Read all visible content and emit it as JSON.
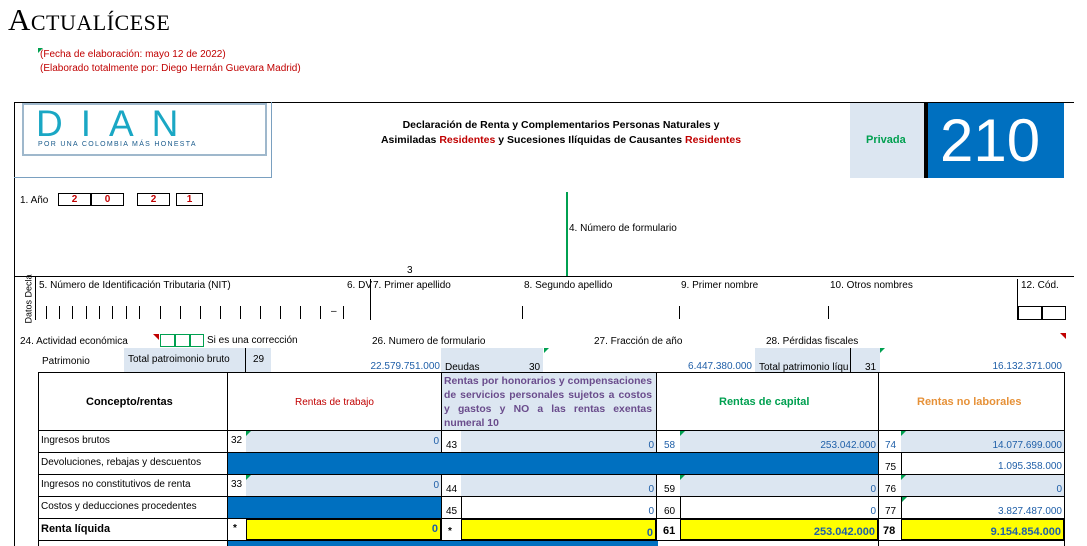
{
  "brand": "Actualícese",
  "notes": {
    "date": "(Fecha de elaboración: mayo 12 de 2022)",
    "author": "(Elaborado totalmente por: Diego Hernán Guevara Madrid)"
  },
  "header": {
    "logo_text": "DIAN",
    "logo_slogan": "POR UNA COLOMBIA MÁS HONESTA",
    "title_line1": "Declaración de Renta y Complementarios Personas Naturales y",
    "title_line2_a": "Asimiladas ",
    "title_line2_b": "Residentes",
    "title_line2_c": " y Sucesiones Ilíquidas de Causantes ",
    "title_line2_d": "Residentes",
    "privacy": "Privada",
    "form_number": "210"
  },
  "year": {
    "label": "1. Año",
    "digits": [
      "2",
      "0",
      "2",
      "1"
    ]
  },
  "form_number_label": "4. Número de formulario",
  "field3": "3",
  "side_label": "Datos Decla",
  "id_fields": {
    "nit": "5. Número de Identificación Tributaria (NIT)",
    "dv": "6. DV",
    "first_surname": "7. Primer apellido",
    "second_surname": "8. Segundo apellido",
    "first_name": "9. Primer nombre",
    "other_names": "10. Otros nombres",
    "code": "12. Cód.",
    "dash": "–"
  },
  "row24": {
    "activity": "24. Actividad económica",
    "correction": "Si es una corrección",
    "form_number": "26. Numero de formulario",
    "fraction": "27. Fracción de año",
    "losses": "28. Pérdidas fiscales"
  },
  "patrimonio": {
    "label": "Patrimonio",
    "gross_label": "Total patroimonio bruto",
    "gross_code": "29",
    "gross_value": "22.579.751.000",
    "debts_label": "Deudas",
    "debts_code": "30",
    "debts_value": "6.447.380.000",
    "net_label": "Total patrimonio líqu",
    "net_code": "31",
    "net_value": "16.132.371.000"
  },
  "table": {
    "concept_header": "Concepto/rentas",
    "col_trabajo": "Rentas de trabajo",
    "col_honorarios": "Rentas por honorarios y compensaciones de servicios personales sujetos a costos y gastos y NO a las rentas exentas numeral 10",
    "col_capital": "Rentas de capital",
    "col_no_laborales": "Rentas no laborales",
    "rows": [
      {
        "label": "Ingresos brutos",
        "c1": "32",
        "v1": "0",
        "c2": "43",
        "v2": "0",
        "c3": "58",
        "v3": "253.042.000",
        "c4": "74",
        "v4": "14.077.699.000"
      },
      {
        "label": "Devoluciones, rebajas y descuentos",
        "c4": "75",
        "v4": "1.095.358.000"
      },
      {
        "label": "Ingresos no constitutivos de renta",
        "c1": "33",
        "v1": "0",
        "c2": "44",
        "v2": "0",
        "c3": "59",
        "v3": "0",
        "c4": "76",
        "v4": "0"
      },
      {
        "label": "Costos y deducciones procedentes",
        "c2": "45",
        "v2": "0",
        "c3": "60",
        "v3": "0",
        "c4": "77",
        "v4": "3.827.487.000"
      },
      {
        "label": "Renta líquida",
        "c1": "*",
        "v1": "0",
        "c2": "*",
        "v2": "0",
        "c3": "61",
        "v3": "253.042.000",
        "c4": "78",
        "v4": "9.154.854.000"
      }
    ]
  },
  "colors": {
    "blue": "#0070c0",
    "light_blue": "#dce6f1",
    "yellow": "#ffff00",
    "red": "#c00000",
    "green": "#00a050",
    "orange": "#e69138"
  }
}
